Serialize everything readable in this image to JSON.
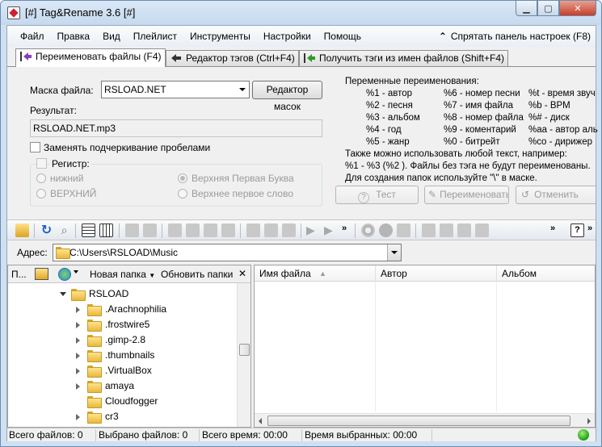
{
  "window": {
    "title": "[#] Tag&Rename 3.6 [#]"
  },
  "menu": {
    "items": [
      "Файл",
      "Правка",
      "Вид",
      "Плейлист",
      "Инструменты",
      "Настройки",
      "Помощь"
    ],
    "hide_panel": "Спрятать панель настроек (F8)"
  },
  "tabs": [
    {
      "label": "Переименовать файлы (F4)",
      "active": true
    },
    {
      "label": "Редактор тэгов (Ctrl+F4)",
      "active": false
    },
    {
      "label": "Получить тэги из имен файлов (Shift+F4)",
      "active": false
    }
  ],
  "rename": {
    "mask_label": "Маска файла:",
    "mask_value": "RSLOAD.NET",
    "mask_editor_button": "Редактор масок",
    "result_label": "Результат:",
    "result_value": "RSLOAD.NET.mp3",
    "replace_underscore": "Заменять подчеркивание пробелами",
    "register": {
      "label": "Регистр:",
      "lower": "нижний",
      "upper": "ВЕРХНИЙ",
      "title_case": "Верхняя Первая Буква",
      "sentence_case": "Верхнее первое слово"
    },
    "vars_title": "Переменные переименования:",
    "vars": [
      [
        "%1 - автор",
        "%6 - номер песни",
        "%t - время звуч"
      ],
      [
        "%2 - песня",
        "%7 - имя файла",
        "%b - BPM"
      ],
      [
        "%3 - альбом",
        "%8 - номер файла",
        "%# - диск"
      ],
      [
        "%4 - год",
        "%9 - коментарий",
        "%aa - автор аль"
      ],
      [
        "%5 - жанр",
        "%0 - битрейт",
        "%co - дирижер"
      ]
    ],
    "note1": "Также можно использовать любой текст, например:",
    "note2": "%1 - %3 (%2 ). Файлы без тэга не будут переименованы.",
    "note3": "Для создания папок используйте \"\\\" в маске.",
    "btn_test": "Тест",
    "btn_rename": "Переименовать",
    "btn_cancel": "Отменить"
  },
  "address": {
    "label": "Адрес:",
    "value": "C:\\Users\\RSLOAD\\Music"
  },
  "tree": {
    "toolbar_p": "П...",
    "new_folder": "Новая папка",
    "refresh": "Обновить папки",
    "close": "✕",
    "items": [
      {
        "name": "RSLOAD",
        "level": 0,
        "expander": "down"
      },
      {
        "name": ".Arachnophilia",
        "level": 1,
        "expander": "right"
      },
      {
        "name": ".frostwire5",
        "level": 1,
        "expander": "right"
      },
      {
        "name": ".gimp-2.8",
        "level": 1,
        "expander": "right"
      },
      {
        "name": ".thumbnails",
        "level": 1,
        "expander": "right"
      },
      {
        "name": ".VirtualBox",
        "level": 1,
        "expander": "right"
      },
      {
        "name": "amaya",
        "level": 1,
        "expander": "right"
      },
      {
        "name": "Cloudfogger",
        "level": 1,
        "expander": "none"
      },
      {
        "name": "cr3",
        "level": 1,
        "expander": "right"
      }
    ]
  },
  "list": {
    "columns": [
      "Имя файла",
      "Автор",
      "Альбом"
    ]
  },
  "status": {
    "total_files": "Всего файлов: 0",
    "selected_files": "Выбрано файлов: 0",
    "total_time": "Всего время: 00:00",
    "selected_time": "Время выбранных: 00:00"
  }
}
